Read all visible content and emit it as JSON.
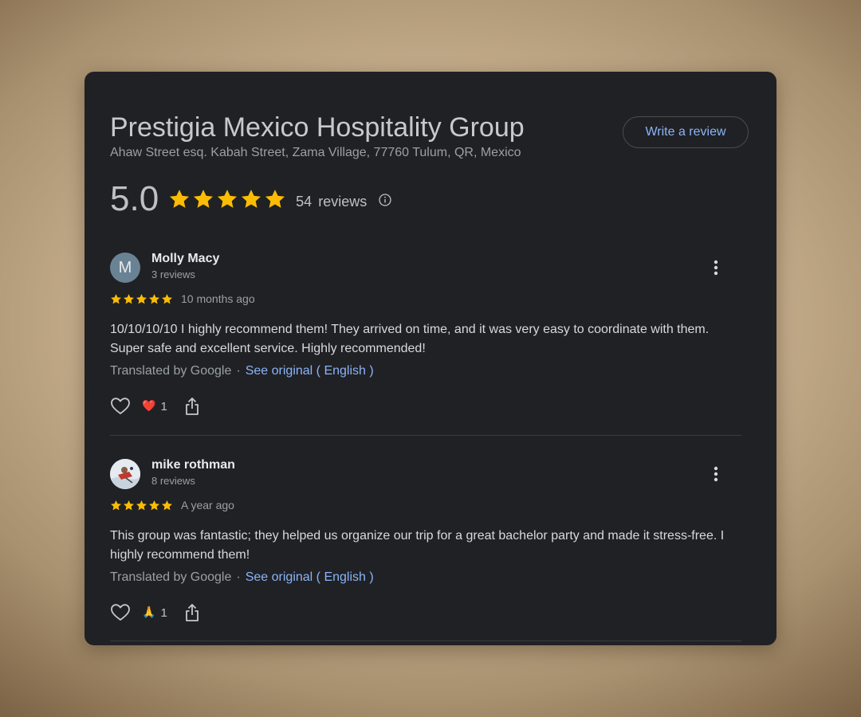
{
  "place": {
    "name": "Prestigia Mexico Hospitality Group",
    "address": "Ahaw Street esq. Kabah Street, Zama Village, 77760 Tulum, QR, Mexico",
    "write_review_label": "Write a review",
    "rating": "5.0",
    "stars": 5,
    "review_count": "54",
    "reviews_word": "reviews"
  },
  "colors": {
    "star": "#fbbc04",
    "link": "#8ab4f8",
    "panel_bg": "#202124"
  },
  "icons": {
    "info": "info-icon",
    "more": "more-vertical-icon",
    "like": "heart-outline-icon",
    "share": "share-icon"
  },
  "reviews": [
    {
      "initial": "M",
      "name": "Molly Macy",
      "meta": "3 reviews",
      "stars": 5,
      "date": "10 months ago",
      "text": "10/10/10/10 I highly recommend them! They arrived on time, and it was very easy to coordinate with them. Super safe and excellent service. Highly recommended!",
      "translated_by": "Translated by Google",
      "separator": "·",
      "see_original": "See original ( English )",
      "reaction_emoji": "❤️",
      "reaction_count": "1"
    },
    {
      "initial": "",
      "name": "mike rothman",
      "meta": "8 reviews",
      "stars": 5,
      "date": "A year ago",
      "text": "This group was fantastic; they helped us organize our trip for a great bachelor party and made it stress-free. I highly recommend them!",
      "translated_by": "Translated by Google",
      "separator": "·",
      "see_original": "See original ( English )",
      "reaction_emoji": "🙏",
      "reaction_count": "1"
    }
  ]
}
